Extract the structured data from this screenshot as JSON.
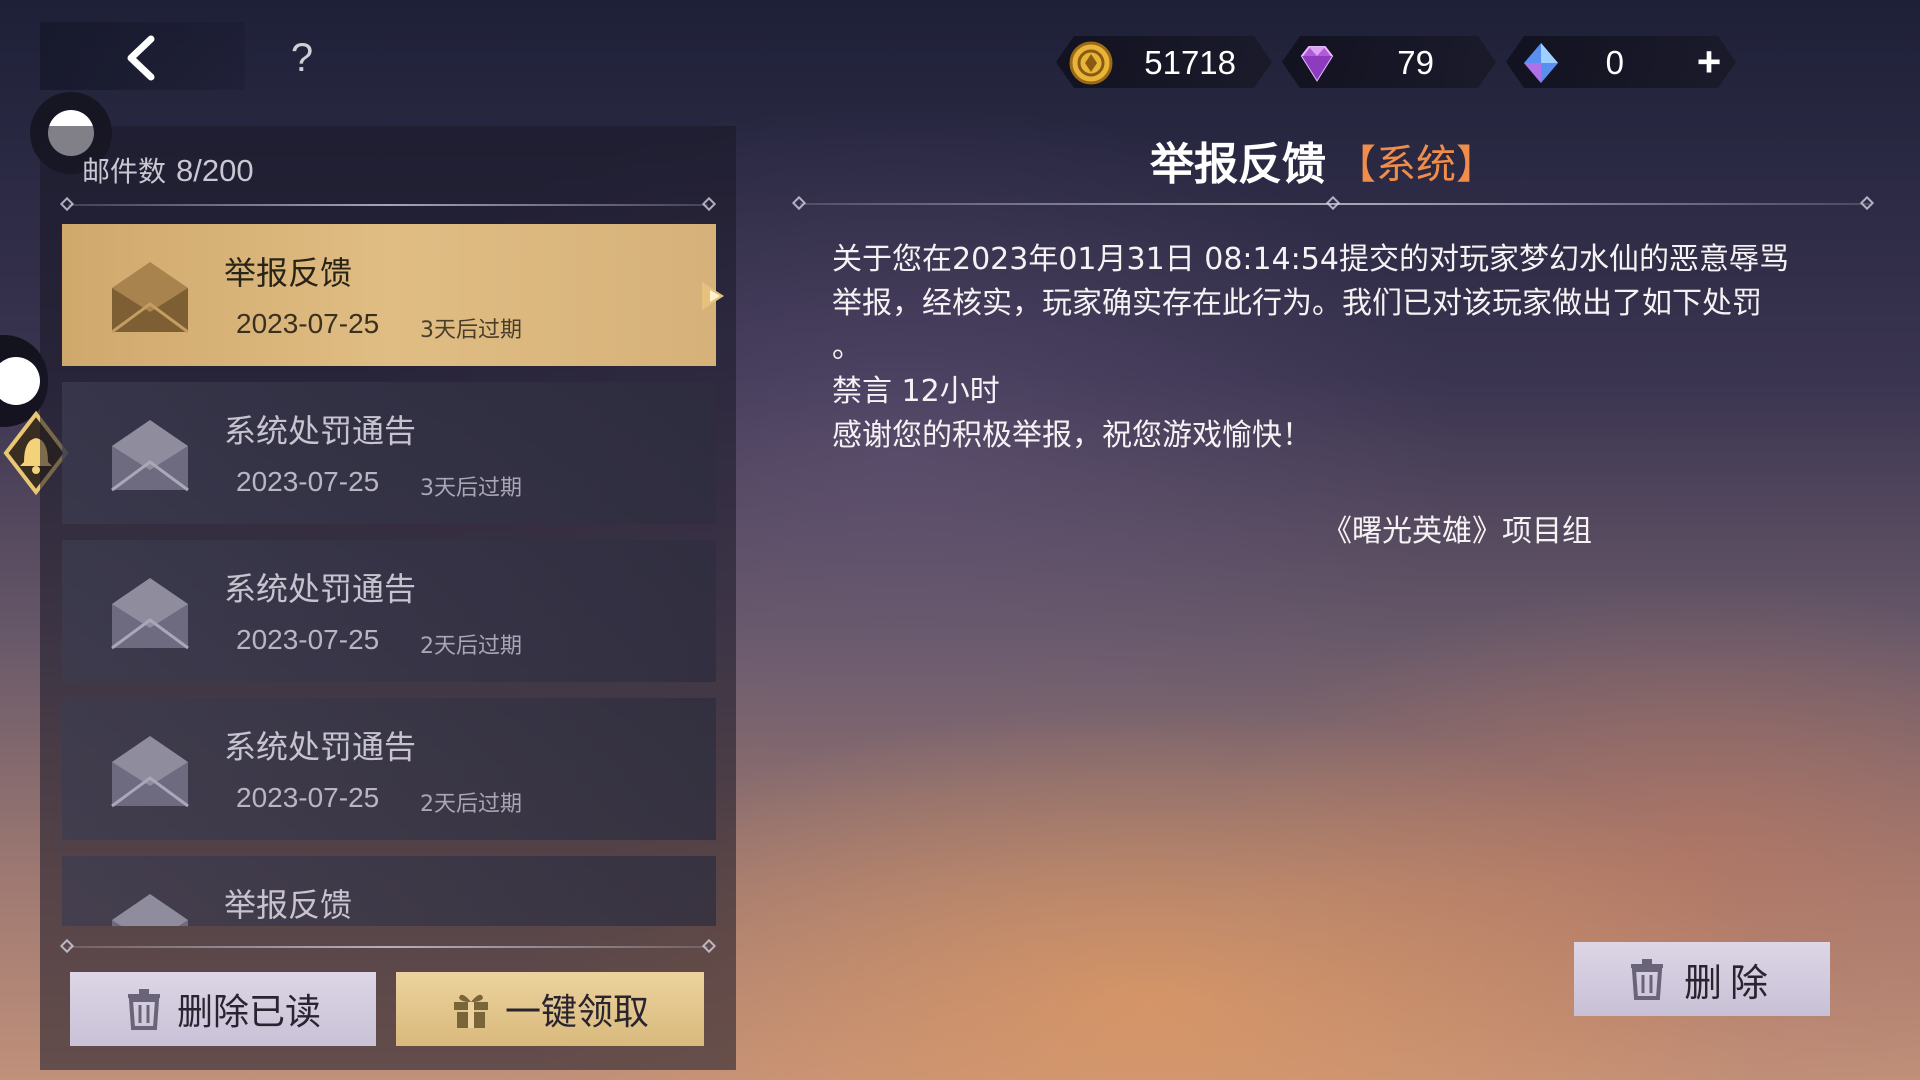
{
  "header": {
    "help_label": "?",
    "currencies": [
      {
        "name": "gold-coin",
        "value": "51718"
      },
      {
        "name": "purple-diamond",
        "value": "79"
      },
      {
        "name": "blue-crystal",
        "value": "0"
      }
    ],
    "add_label": "+"
  },
  "mail_list": {
    "count_label": "邮件数",
    "count_value": "8/200",
    "items": [
      {
        "title": "举报反馈",
        "date": "2023-07-25",
        "expire": "3天后过期",
        "selected": true
      },
      {
        "title": "系统处罚通告",
        "date": "2023-07-25",
        "expire": "3天后过期",
        "selected": false
      },
      {
        "title": "系统处罚通告",
        "date": "2023-07-25",
        "expire": "2天后过期",
        "selected": false
      },
      {
        "title": "系统处罚通告",
        "date": "2023-07-25",
        "expire": "2天后过期",
        "selected": false
      },
      {
        "title": "举报反馈",
        "date": "",
        "expire": "",
        "selected": false
      }
    ],
    "delete_read_label": "删除已读",
    "claim_all_label": "一键领取"
  },
  "detail": {
    "title": "举报反馈",
    "tag": "【系统】",
    "body_line1": "关于您在2023年01月31日 08:14:54提交的对玩家梦幻水仙的恶意辱骂",
    "body_line2": "举报，经核实，玩家确实存在此行为。我们已对该玩家做出了如下处罚",
    "body_line3": "。",
    "body_line4": "禁言 12小时",
    "body_line5": "感谢您的积极举报，祝您游戏愉快！",
    "signature": "《曙光英雄》项目组",
    "delete_label": "删除"
  },
  "colors": {
    "active_item": "#d9b57a",
    "tag": "#f08d4a"
  }
}
